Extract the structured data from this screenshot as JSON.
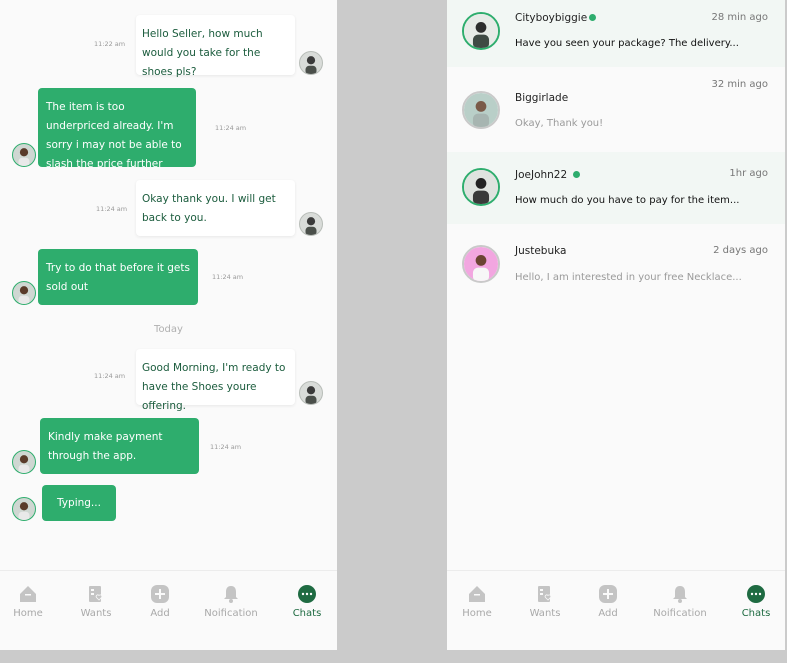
{
  "chat": {
    "messages": [
      {
        "direction": "out",
        "text": "Hello Seller, how much would you take for the shoes pls?",
        "time": "11:22 am"
      },
      {
        "direction": "in",
        "text": "The item is too underpriced already. I'm sorry i may not be able to slash the price further",
        "time": "11:24 am"
      },
      {
        "direction": "out",
        "text": "Okay thank you. I will get back to you.",
        "time": "11:24 am"
      },
      {
        "direction": "in",
        "text": "Try to do that before it gets sold out",
        "time": "11:24 am"
      },
      {
        "direction": "out",
        "text": "Good Morning, I'm ready to have the Shoes youre offering.",
        "time": "11:24 am"
      },
      {
        "direction": "in",
        "text": "Kindly make payment through the app.",
        "time": "11:24 am"
      }
    ],
    "divider_today": "Today",
    "typing": "Typing..."
  },
  "conversations": [
    {
      "name": "Cityboybiggie",
      "online": true,
      "time": "28 min ago",
      "preview": "Have you seen your package? The delivery...",
      "unread": true
    },
    {
      "name": "Biggirlade",
      "online": false,
      "time": "32 min ago",
      "preview": "Okay, Thank you!",
      "unread": false
    },
    {
      "name": "JoeJohn22",
      "online": true,
      "time": "1hr ago",
      "preview": "How much do you have to pay for the item...",
      "unread": true
    },
    {
      "name": "Justebuka",
      "online": false,
      "time": "2 days ago",
      "preview": "Hello, I am interested in your free Necklace...",
      "unread": false
    }
  ],
  "nav": {
    "home": "Home",
    "wants": "Wants",
    "add": "Add",
    "notification": "Noification",
    "chats": "Chats",
    "active": "chats"
  },
  "colors": {
    "accent": "#2ead6d",
    "accent_dark": "#1f6b42",
    "icon_gray": "#c4c4c4"
  }
}
